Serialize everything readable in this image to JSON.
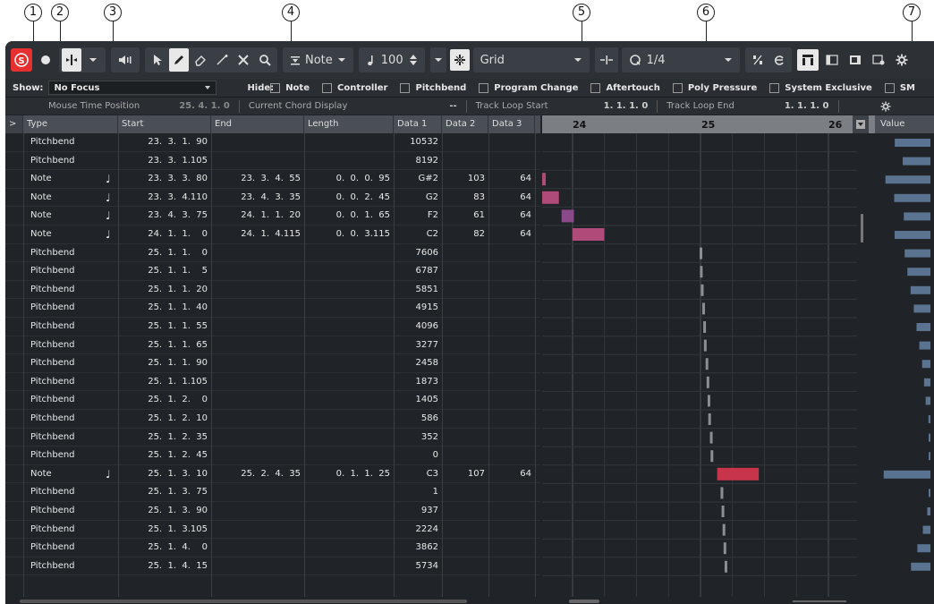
{
  "callouts": [
    "1",
    "2",
    "3",
    "4",
    "5",
    "6",
    "7"
  ],
  "toolbar": {
    "note_label": "Note",
    "velocity_value": "100",
    "grid_label": "Grid",
    "quantize_value": "1/4"
  },
  "filter": {
    "show_label": "Show:",
    "show_value": "No Focus",
    "hide_label": "Hide:",
    "options": [
      "Note",
      "Controller",
      "Pitchbend",
      "Program Change",
      "Aftertouch",
      "Poly Pressure",
      "System Exclusive",
      "SM"
    ]
  },
  "info": {
    "mouse_time_label": "Mouse Time Position",
    "mouse_time_value": "25.  4.  1.   0",
    "chord_label": "Current Chord Display",
    "chord_value": "--",
    "loop_start_label": "Track Loop Start",
    "loop_start_value": "1.  1.  1.   0",
    "loop_end_label": "Track Loop End",
    "loop_end_value": "1.  1.  1.   0"
  },
  "columns": [
    "Type",
    "Start",
    "End",
    "Length",
    "Data 1",
    "Data 2",
    "Data 3"
  ],
  "expand_label": ">",
  "ruler": {
    "bar24": "24",
    "bar25": "25",
    "bar26": "26"
  },
  "value_header": "Value",
  "rows": [
    {
      "type": "Pitchbend",
      "note": false,
      "start": "23.  3.  1.  90",
      "end": "",
      "length": "",
      "d1": "10532",
      "d2": "",
      "d3": ""
    },
    {
      "type": "Pitchbend",
      "note": false,
      "start": "23.  3.  1.105",
      "end": "",
      "length": "",
      "d1": "8192",
      "d2": "",
      "d3": ""
    },
    {
      "type": "Note",
      "note": true,
      "start": "23.  3.  3.  80",
      "end": "23.  3.  4.  55",
      "length": "0.  0.  0.  95",
      "d1": "G#2",
      "d2": "103",
      "d3": "64"
    },
    {
      "type": "Note",
      "note": true,
      "start": "23.  3.  4.110",
      "end": "23.  4.  3.  35",
      "length": "0.  0.  2.  45",
      "d1": "G2",
      "d2": "83",
      "d3": "64"
    },
    {
      "type": "Note",
      "note": true,
      "start": "23.  4.  3.  75",
      "end": "24.  1.  1.  20",
      "length": "0.  0.  1.  65",
      "d1": "F2",
      "d2": "61",
      "d3": "64"
    },
    {
      "type": "Note",
      "note": true,
      "start": "24.  1.  1.    0",
      "end": "24.  1.  4.115",
      "length": "0.  0.  3.115",
      "d1": "C2",
      "d2": "82",
      "d3": "64"
    },
    {
      "type": "Pitchbend",
      "note": false,
      "start": "25.  1.  1.    0",
      "end": "",
      "length": "",
      "d1": "7606",
      "d2": "",
      "d3": ""
    },
    {
      "type": "Pitchbend",
      "note": false,
      "start": "25.  1.  1.    5",
      "end": "",
      "length": "",
      "d1": "6787",
      "d2": "",
      "d3": ""
    },
    {
      "type": "Pitchbend",
      "note": false,
      "start": "25.  1.  1.  20",
      "end": "",
      "length": "",
      "d1": "5851",
      "d2": "",
      "d3": ""
    },
    {
      "type": "Pitchbend",
      "note": false,
      "start": "25.  1.  1.  40",
      "end": "",
      "length": "",
      "d1": "4915",
      "d2": "",
      "d3": ""
    },
    {
      "type": "Pitchbend",
      "note": false,
      "start": "25.  1.  1.  55",
      "end": "",
      "length": "",
      "d1": "4096",
      "d2": "",
      "d3": ""
    },
    {
      "type": "Pitchbend",
      "note": false,
      "start": "25.  1.  1.  65",
      "end": "",
      "length": "",
      "d1": "3277",
      "d2": "",
      "d3": ""
    },
    {
      "type": "Pitchbend",
      "note": false,
      "start": "25.  1.  1.  90",
      "end": "",
      "length": "",
      "d1": "2458",
      "d2": "",
      "d3": ""
    },
    {
      "type": "Pitchbend",
      "note": false,
      "start": "25.  1.  1.105",
      "end": "",
      "length": "",
      "d1": "1873",
      "d2": "",
      "d3": ""
    },
    {
      "type": "Pitchbend",
      "note": false,
      "start": "25.  1.  2.    0",
      "end": "",
      "length": "",
      "d1": "1405",
      "d2": "",
      "d3": ""
    },
    {
      "type": "Pitchbend",
      "note": false,
      "start": "25.  1.  2.  10",
      "end": "",
      "length": "",
      "d1": "586",
      "d2": "",
      "d3": ""
    },
    {
      "type": "Pitchbend",
      "note": false,
      "start": "25.  1.  2.  35",
      "end": "",
      "length": "",
      "d1": "352",
      "d2": "",
      "d3": ""
    },
    {
      "type": "Pitchbend",
      "note": false,
      "start": "25.  1.  2.  45",
      "end": "",
      "length": "",
      "d1": "0",
      "d2": "",
      "d3": ""
    },
    {
      "type": "Note",
      "note": true,
      "start": "25.  1.  3.  10",
      "end": "25.  2.  4.  35",
      "length": "0.  1.  1.  25",
      "d1": "C3",
      "d2": "107",
      "d3": "64"
    },
    {
      "type": "Pitchbend",
      "note": false,
      "start": "25.  1.  3.  75",
      "end": "",
      "length": "",
      "d1": "1",
      "d2": "",
      "d3": ""
    },
    {
      "type": "Pitchbend",
      "note": false,
      "start": "25.  1.  3.  90",
      "end": "",
      "length": "",
      "d1": "937",
      "d2": "",
      "d3": ""
    },
    {
      "type": "Pitchbend",
      "note": false,
      "start": "25.  1.  3.105",
      "end": "",
      "length": "",
      "d1": "2224",
      "d2": "",
      "d3": ""
    },
    {
      "type": "Pitchbend",
      "note": false,
      "start": "25.  1.  4.    0",
      "end": "",
      "length": "",
      "d1": "3862",
      "d2": "",
      "d3": ""
    },
    {
      "type": "Pitchbend",
      "note": false,
      "start": "25.  1.  4.  15",
      "end": "",
      "length": "",
      "d1": "5734",
      "d2": "",
      "d3": ""
    }
  ],
  "colors": {
    "note_red": "#c8344a",
    "note_purple": "#8a4a8a",
    "note_pink": "#b04a78",
    "pitch_bar": "#8a8f95",
    "value_bar": "#5a7390",
    "record_red": "#e63030"
  }
}
